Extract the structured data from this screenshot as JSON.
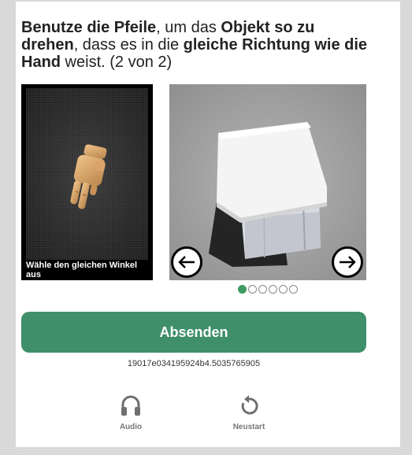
{
  "instruction": {
    "part1_bold": "Benutze die Pfeile",
    "part2": ", um das ",
    "part3_bold": "Objekt so zu drehen",
    "part4": ", dass es in die ",
    "part5_bold": "gleiche Richtung wie die Hand",
    "part6": " weist. (2 von 2)"
  },
  "reference_panel": {
    "caption": "Wähle den gleichen Winkel aus"
  },
  "progress": {
    "total": 6,
    "current": 1
  },
  "submit_label": "Absenden",
  "session_id": "19017e034195924b4.5035765905",
  "tools": {
    "audio_label": "Audio",
    "restart_label": "Neustart"
  },
  "colors": {
    "accent": "#3f8f6b",
    "active_dot": "#3e9a62"
  },
  "icons": {
    "left_arrow": "arrow-left-icon",
    "right_arrow": "arrow-right-icon",
    "audio": "headphones-icon",
    "restart": "restart-icon"
  }
}
